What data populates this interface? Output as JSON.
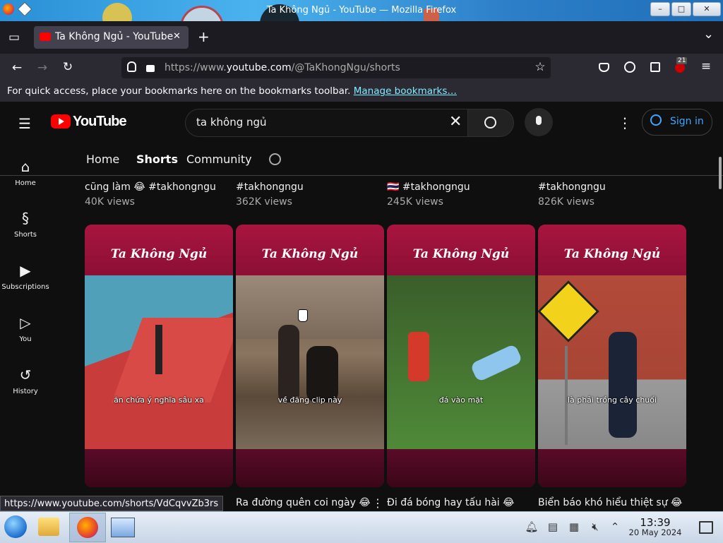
{
  "window": {
    "title": "Ta Không Ngủ - YouTube — Mozilla Firefox",
    "btn_min": "–",
    "btn_max": "□",
    "btn_close": "✕"
  },
  "tabs": [
    {
      "label": "Ta Không Ngủ - YouTube",
      "close": "✕",
      "active": true
    }
  ],
  "tab_new": "+",
  "tab_list": "⌄",
  "nav": {
    "url_prefix": "https://www.",
    "url_domain": "youtube.com",
    "url_path": "/@TaKhongNgu/shorts",
    "back": "←",
    "forward": "→",
    "reload": "↻",
    "star": "☆",
    "menu": "≡",
    "extension_badge": "21"
  },
  "bookmarks_bar": {
    "text": "For quick access, place your bookmarks here on the bookmarks toolbar.",
    "link": "Manage bookmarks…"
  },
  "youtube": {
    "logo_text": "YouTube",
    "search_value": "ta không ngủ",
    "sign_in": "Sign in",
    "more": "⋮",
    "menu": "☰",
    "channel_tabs": [
      "Home",
      "Shorts",
      "Community"
    ],
    "active_tab": "Shorts",
    "sidebar": [
      {
        "label": "Home",
        "icon": "home-icon",
        "glyph": "⌂"
      },
      {
        "label": "Shorts",
        "icon": "shorts-icon",
        "glyph": "§"
      },
      {
        "label": "Subscriptions",
        "icon": "subscriptions-icon",
        "glyph": "▶"
      },
      {
        "label": "You",
        "icon": "you-icon",
        "glyph": "▷"
      },
      {
        "label": "History",
        "icon": "history-icon",
        "glyph": "↺"
      }
    ],
    "previous_row": [
      {
        "title_line2": "cũng làm 😂 #takhongngu",
        "views": "40K views"
      },
      {
        "title_line2": "#takhongngu",
        "views": "362K views"
      },
      {
        "title_line2": "🇹🇭 #takhongngu",
        "views": "245K views"
      },
      {
        "title_line2": "#takhongngu",
        "views": "826K views"
      }
    ],
    "shorts": [
      {
        "brand": "Ta Không Ngủ",
        "caption": "ăn chứa ý nghĩa sâu xa",
        "title": "",
        "scene": "stairs"
      },
      {
        "brand": "Ta Không Ngủ",
        "caption": "về đăng clip này",
        "title": "Ra đường quên coi ngày 😂",
        "scene": "castle"
      },
      {
        "brand": "Ta Không Ngủ",
        "caption": "đá vào mặt",
        "title": "Đi đá bóng hay tấu hài 😂",
        "scene": "football"
      },
      {
        "brand": "Ta Không Ngủ",
        "caption": "là phải trồng cây chuối",
        "title": "Biển báo khó hiểu thiệt sự 😂",
        "scene": "sign"
      }
    ]
  },
  "status_link": "https://www.youtube.com/shorts/VdCqvvZb3rs",
  "taskbar": {
    "time": "13:39",
    "date": "20 May 2024"
  },
  "colors": {
    "yt_red": "#ff0000",
    "card_maroon": "#8c0f35",
    "link_blue": "#3ea6ff"
  }
}
